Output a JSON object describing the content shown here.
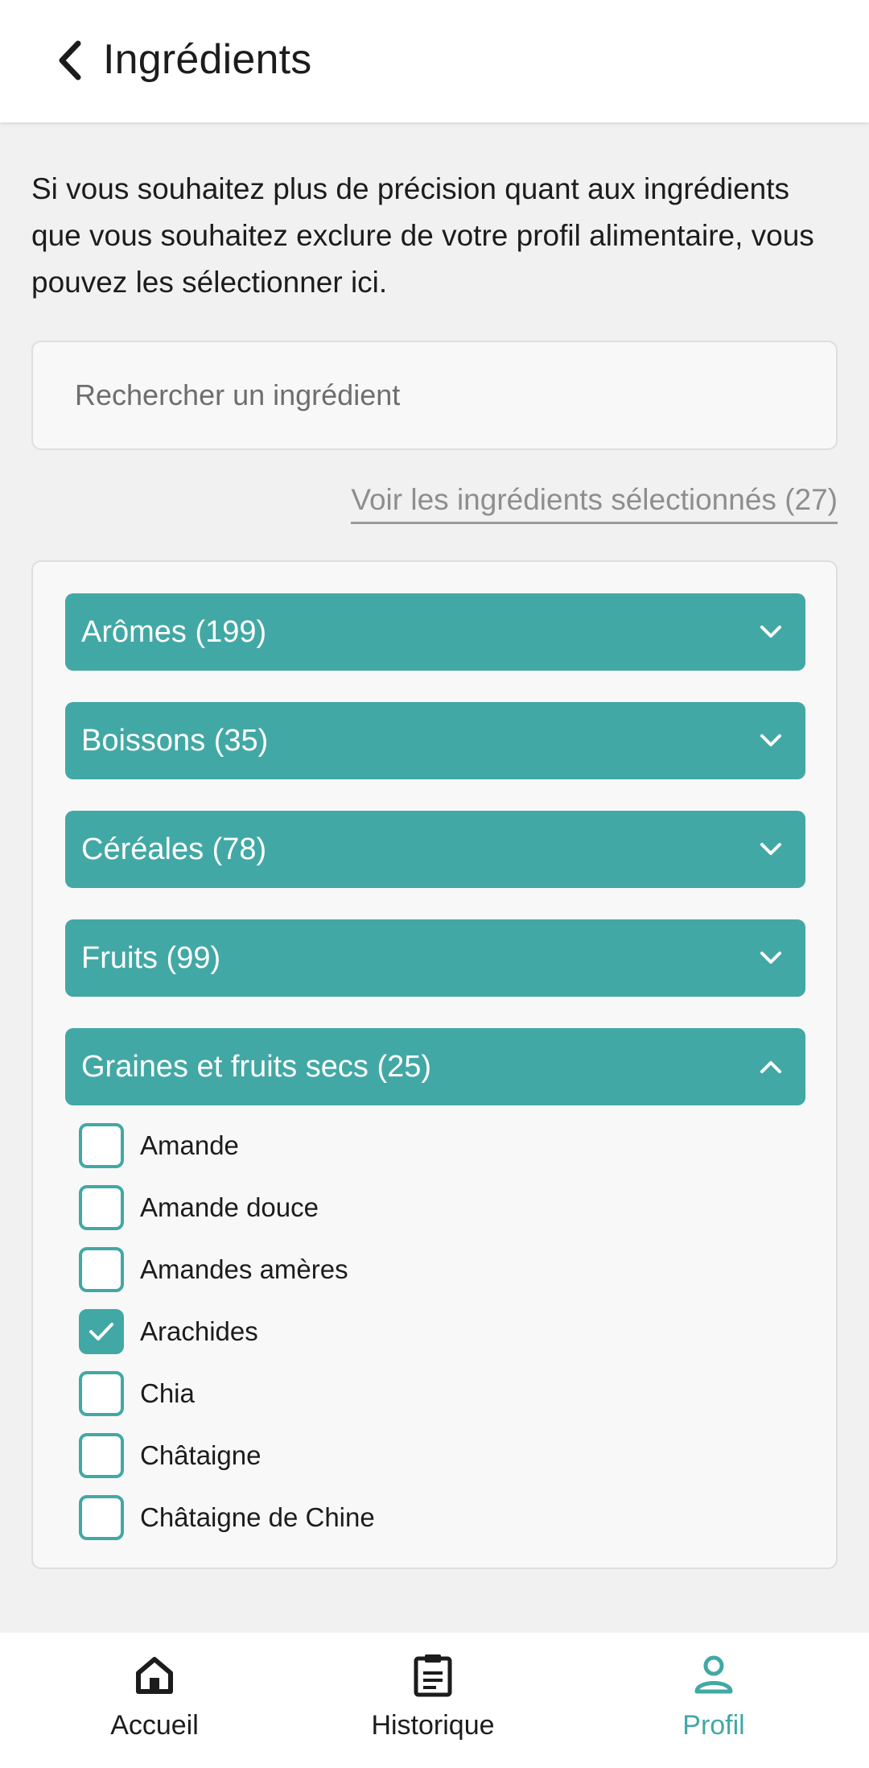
{
  "header": {
    "title": "Ingrédients"
  },
  "intro": {
    "text": "Si vous souhaitez plus de précision quant aux ingrédients que vous souhaitez exclure de votre profil alimentaire, vous pouvez les sélectionner ici."
  },
  "search": {
    "placeholder": "Rechercher un ingrédient",
    "value": ""
  },
  "selected_link": {
    "label": "Voir les ingrédients sélectionnés (27)"
  },
  "categories": [
    {
      "label": "Arômes (199)",
      "expanded": false
    },
    {
      "label": "Boissons (35)",
      "expanded": false
    },
    {
      "label": "Céréales (78)",
      "expanded": false
    },
    {
      "label": "Fruits (99)",
      "expanded": false
    },
    {
      "label": "Graines et fruits secs (25)",
      "expanded": true
    }
  ],
  "expanded_items": [
    {
      "label": "Amande",
      "checked": false
    },
    {
      "label": "Amande douce",
      "checked": false
    },
    {
      "label": "Amandes amères",
      "checked": false
    },
    {
      "label": "Arachides",
      "checked": true
    },
    {
      "label": "Chia",
      "checked": false
    },
    {
      "label": "Châtaigne",
      "checked": false
    },
    {
      "label": "Châtaigne de Chine",
      "checked": false
    }
  ],
  "bottom_nav": {
    "items": [
      {
        "label": "Accueil",
        "icon": "home-icon",
        "active": false
      },
      {
        "label": "Historique",
        "icon": "clipboard-icon",
        "active": false
      },
      {
        "label": "Profil",
        "icon": "person-icon",
        "active": true
      }
    ]
  },
  "colors": {
    "accent": "#42a8a5",
    "text": "#1c1c1c",
    "muted": "#8e8e8e",
    "background": "#f1f1f1"
  }
}
